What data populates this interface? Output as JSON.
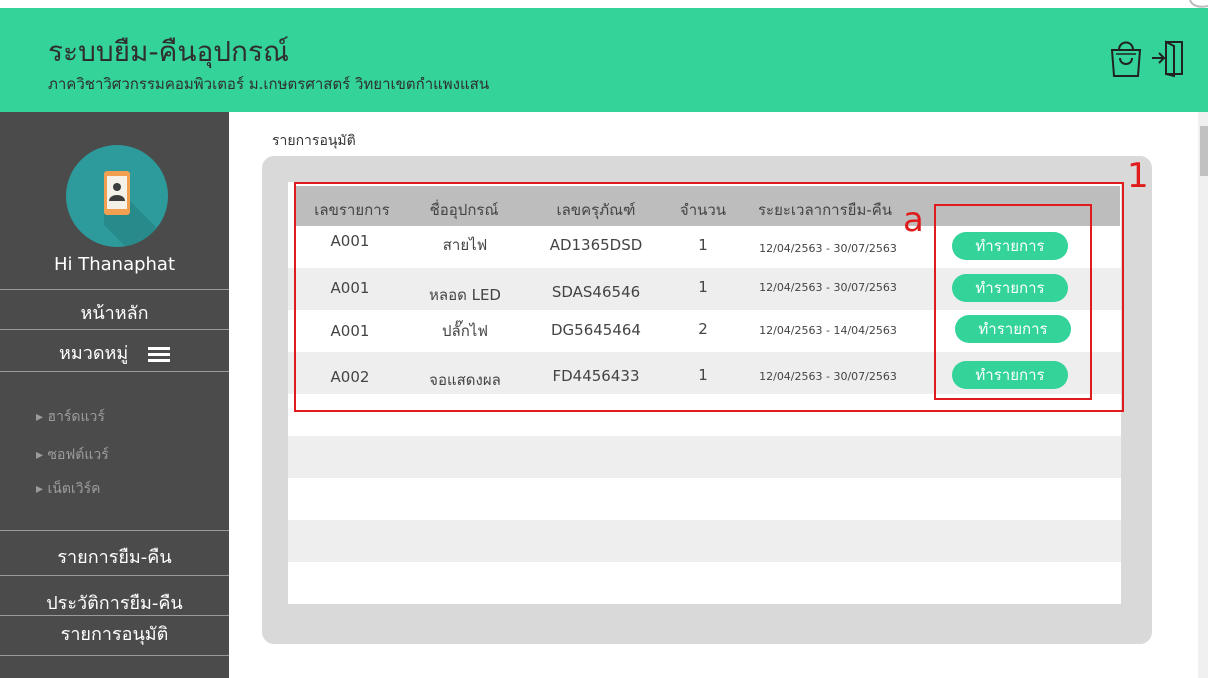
{
  "header": {
    "title": "ระบบยืม-คืนอุปกรณ์",
    "subtitle": "ภาควิชาวิศวกรรมคอมพิวเตอร์ ม.เกษตรศาสตร์ วิทยาเขตกำแพงแสน",
    "bg_color": "#33d39a",
    "icons": [
      "shopping-bag-icon",
      "logout-icon"
    ]
  },
  "sidebar": {
    "greeting": "Hi Thanaphat",
    "home": "หน้าหลัก",
    "category": "หมวดหมู่",
    "subcategories": [
      "▸ ฮาร์ดแวร์",
      "▸ ซอฟต์แวร์",
      "▸ เน็ตเวิร์ค"
    ],
    "borrow_list": "รายการยืม-คืน",
    "history": "ประวัติการยืม-คืน",
    "approval": "รายการอนุมัติ"
  },
  "main": {
    "page_label": "รายการอนุมัติ",
    "table": {
      "headers": [
        "เลขรายการ",
        "ชื่ออุปกรณ์",
        "เลขครุภัณฑ์",
        "จำนวน",
        "ระยะเวลาการยืม-คืน"
      ],
      "rows": [
        {
          "id": "A001",
          "name": "สายไฟ",
          "asset": "AD1365DSD",
          "qty": "1",
          "period": "12/04/2563 - 30/07/2563",
          "action": "ทำรายการ"
        },
        {
          "id": "A001",
          "name": "หลอด LED",
          "asset": "SDAS46546",
          "qty": "1",
          "period": "12/04/2563 - 30/07/2563",
          "action": "ทำรายการ"
        },
        {
          "id": "A001",
          "name": "ปลั๊กไฟ",
          "asset": "DG5645464",
          "qty": "2",
          "period": "12/04/2563 - 14/04/2563",
          "action": "ทำรายการ"
        },
        {
          "id": "A002",
          "name": "จอแสดงผล",
          "asset": "FD4456433",
          "qty": "1",
          "period": "12/04/2563 - 30/07/2563",
          "action": "ทำรายการ"
        }
      ]
    }
  },
  "annotations": {
    "box1": "1",
    "boxa": "a",
    "color": "#e01b1b"
  }
}
